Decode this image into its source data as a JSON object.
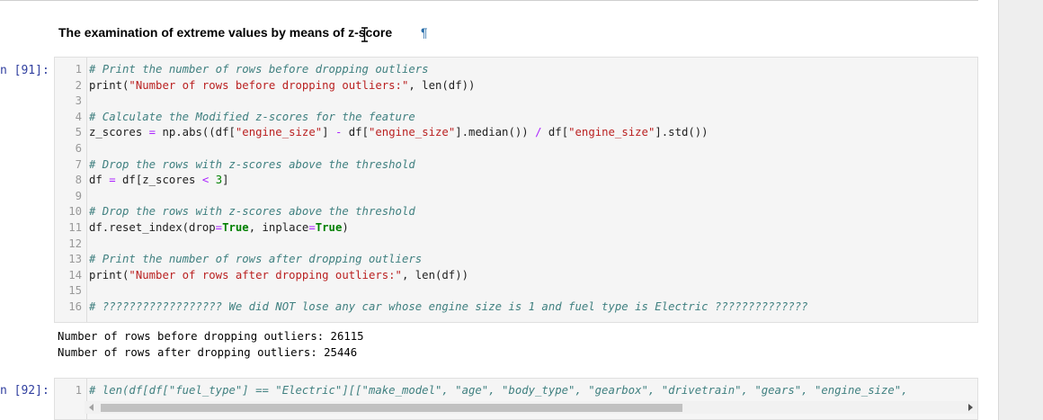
{
  "markdown": {
    "heading": "The examination of extreme values by means of z-score",
    "anchor_symbol": "¶"
  },
  "cell1": {
    "prompt": "n [91]:",
    "lines": [
      {
        "n": "1",
        "html": "<span class=\"cm\"># Print the number of rows before dropping outliers</span>"
      },
      {
        "n": "2",
        "html": "print(<span class=\"st\">\"Number of rows before dropping outliers:\"</span>, len(df))"
      },
      {
        "n": "3",
        "html": ""
      },
      {
        "n": "4",
        "html": "<span class=\"cm\"># Calculate the Modified z-scores for the feature</span>"
      },
      {
        "n": "5",
        "html": "z_scores <span class=\"op\">=</span> np.abs((df[<span class=\"st\">\"engine_size\"</span>] <span class=\"op\">-</span> df[<span class=\"st\">\"engine_size\"</span>].median()) <span class=\"op\">/</span> df[<span class=\"st\">\"engine_size\"</span>].std())"
      },
      {
        "n": "6",
        "html": ""
      },
      {
        "n": "7",
        "html": "<span class=\"cm\"># Drop the rows with z-scores above the threshold</span>"
      },
      {
        "n": "8",
        "html": "df <span class=\"op\">=</span> df[z_scores <span class=\"op\">&lt;</span> <span class=\"nm\">3</span>]"
      },
      {
        "n": "9",
        "html": ""
      },
      {
        "n": "10",
        "html": "<span class=\"cm\"># Drop the rows with z-scores above the threshold</span>"
      },
      {
        "n": "11",
        "html": "df.reset_index(drop<span class=\"op\">=</span><span class=\"kw\">True</span>, inplace<span class=\"op\">=</span><span class=\"kw\">True</span>)"
      },
      {
        "n": "12",
        "html": ""
      },
      {
        "n": "13",
        "html": "<span class=\"cm\"># Print the number of rows after dropping outliers</span>"
      },
      {
        "n": "14",
        "html": "print(<span class=\"st\">\"Number of rows after dropping outliers:\"</span>, len(df))"
      },
      {
        "n": "15",
        "html": ""
      },
      {
        "n": "16",
        "html": "<span class=\"cm\"># ?????????????????? We did NOT lose any car whose engine size is 1 and fuel type is Electric ??????????????</span>"
      }
    ],
    "output_lines": [
      "Number of rows before dropping outliers: 26115",
      "Number of rows after dropping outliers: 25446"
    ]
  },
  "cell2": {
    "prompt": "n [92]:",
    "lines": [
      {
        "n": "1",
        "html": "<span class=\"cm\"># len(df[df[\"fuel_type\"] == \"Electric\"][[\"make_model\", \"age\", \"body_type\", \"gearbox\", \"drivetrain\", \"gears\", \"engine_size\",</span>"
      }
    ]
  }
}
